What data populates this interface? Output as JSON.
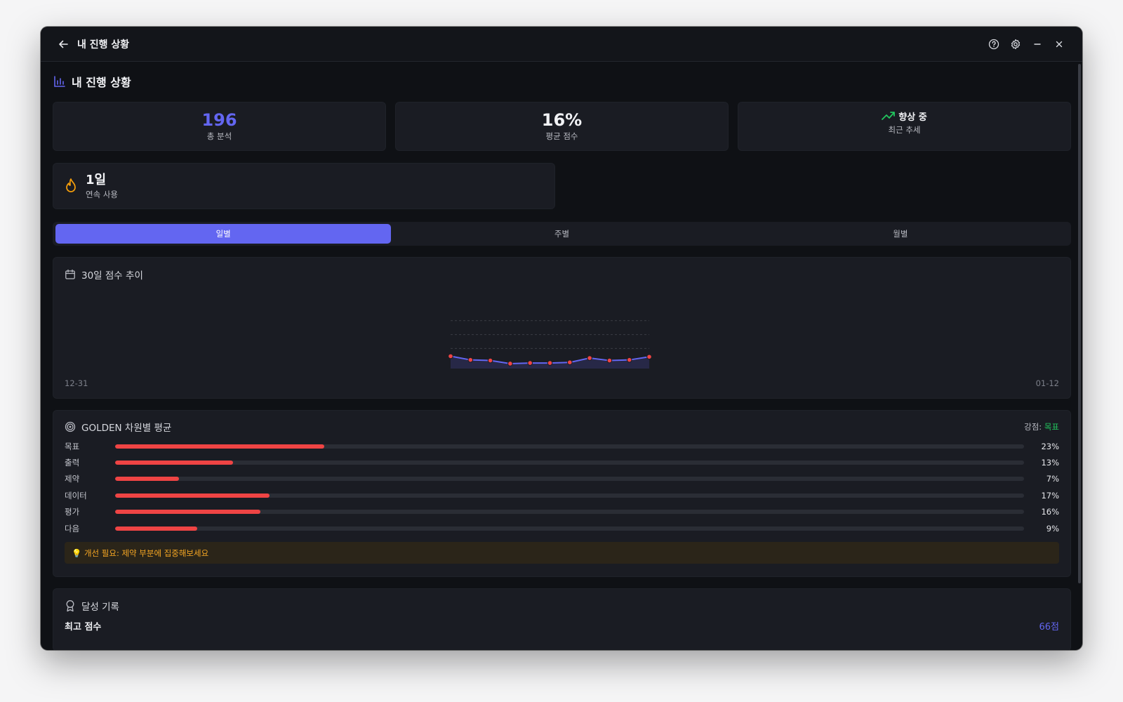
{
  "window": {
    "title": "내 진행 상황"
  },
  "page": {
    "heading": "내 진행 상황"
  },
  "stats": [
    {
      "value": "196",
      "label": "총 분석",
      "color": "#6366f1"
    },
    {
      "value": "16%",
      "label": "평균 점수",
      "color": "#f1f2f5"
    },
    {
      "value": "향상 중",
      "label": "최근 추세",
      "color": "#22c55e"
    }
  ],
  "streak": {
    "value": "1일",
    "label": "연속 사용"
  },
  "tabs": [
    {
      "label": "일별",
      "active": true
    },
    {
      "label": "주별",
      "active": false
    },
    {
      "label": "월별",
      "active": false
    }
  ],
  "trend_chart": {
    "title": "30일 점수 추이",
    "x_start_label": "12-31",
    "x_end_label": "01-12",
    "chart_data": {
      "type": "line",
      "values": [
        20,
        14,
        13,
        8,
        9,
        9,
        10,
        17,
        13,
        14,
        19
      ],
      "ylim": [
        0,
        100
      ],
      "point_color": "#ef4444",
      "line_color": "#6366f1"
    }
  },
  "golden": {
    "title": "GOLDEN 차원별 평균",
    "strength_label": "강점: ",
    "strength_value": "목표",
    "dimensions": [
      {
        "name": "목표",
        "value": 23,
        "label": "23%"
      },
      {
        "name": "출력",
        "value": 13,
        "label": "13%"
      },
      {
        "name": "제약",
        "value": 7,
        "label": "7%"
      },
      {
        "name": "데이터",
        "value": 17,
        "label": "17%"
      },
      {
        "name": "평가",
        "value": 16,
        "label": "16%"
      },
      {
        "name": "다음",
        "value": 9,
        "label": "9%"
      }
    ],
    "tip": "💡 개선 필요: 제약 부분에 집중해보세요"
  },
  "achievements": {
    "title": "달성 기록",
    "best_score_label": "최고 점수",
    "best_score_value": "66점"
  },
  "colors": {
    "accent": "#6366f1",
    "positive": "#22c55e",
    "bar": "#ef4444",
    "warning": "#f5a623"
  }
}
